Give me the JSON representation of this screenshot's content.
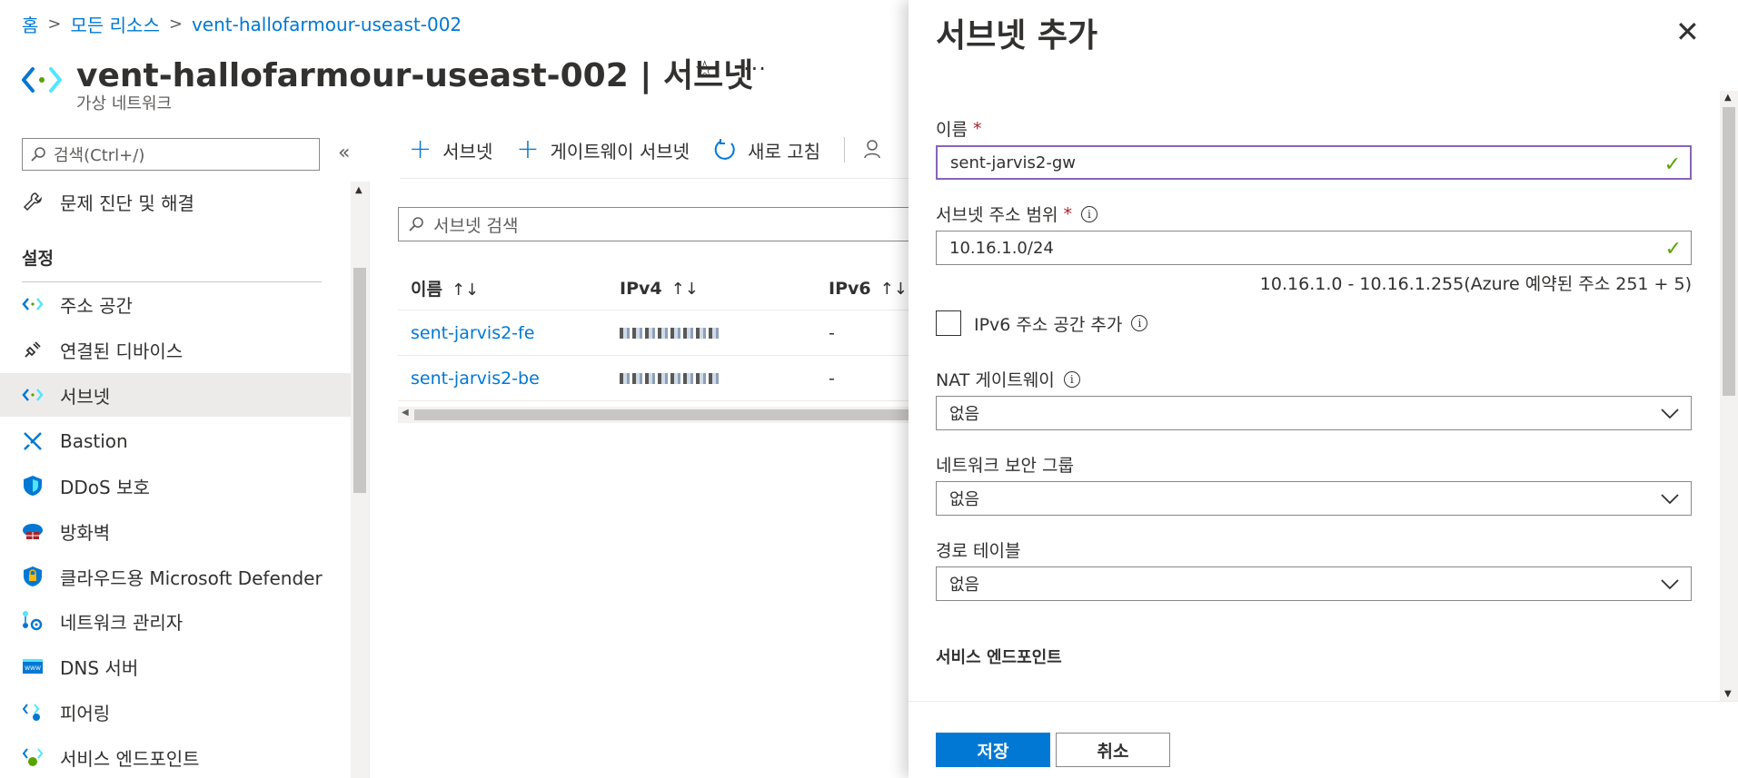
{
  "breadcrumb": {
    "items": [
      "홈",
      "모든 리소스",
      "vent-hallofarmour-useast-002"
    ]
  },
  "header": {
    "title": "vent-hallofarmour-useast-002 | 서브넷",
    "subtitle": "가상 네트워크",
    "star": "☆",
    "more": "···"
  },
  "sidebar": {
    "search_placeholder": "검색(Ctrl+/)",
    "collapse": "«",
    "section_settings": "설정",
    "items": [
      {
        "label": "문제 진단 및 해결",
        "icon": "wrench-icon"
      },
      {
        "label": "주소 공간",
        "icon": "address-space-icon"
      },
      {
        "label": "연결된 디바이스",
        "icon": "plug-icon"
      },
      {
        "label": "서브넷",
        "icon": "subnet-icon"
      },
      {
        "label": "Bastion",
        "icon": "bastion-icon"
      },
      {
        "label": "DDoS 보호",
        "icon": "shield-icon"
      },
      {
        "label": "방화벽",
        "icon": "firewall-icon"
      },
      {
        "label": "클라우드용 Microsoft Defender",
        "icon": "defender-icon"
      },
      {
        "label": "네트워크 관리자",
        "icon": "network-manager-icon"
      },
      {
        "label": "DNS 서버",
        "icon": "dns-icon"
      },
      {
        "label": "피어링",
        "icon": "peering-icon"
      },
      {
        "label": "서비스 엔드포인트",
        "icon": "service-endpoint-icon"
      }
    ]
  },
  "toolbar": {
    "add_subnet": "서브넷",
    "add_gateway_subnet": "게이트웨이 서브넷",
    "refresh": "새로 고침"
  },
  "grid": {
    "search_placeholder": "서브넷 검색",
    "headers": [
      "이름",
      "IPv4",
      "IPv6"
    ],
    "sort": "↑↓",
    "rows": [
      {
        "name": "sent-jarvis2-fe",
        "ipv6": "-"
      },
      {
        "name": "sent-jarvis2-be",
        "ipv6": "-"
      }
    ]
  },
  "panel": {
    "title": "서브넷 추가",
    "close": "✕",
    "name_label": "이름",
    "required": "*",
    "name_value": "sent-jarvis2-gw",
    "range_label": "서브넷 주소 범위",
    "range_value": "10.16.1.0/24",
    "range_hint": "10.16.1.0 - 10.16.1.255(Azure 예약된 주소 251 + 5)",
    "ipv6_checkbox": "IPv6 주소 공간 추가",
    "nat_label": "NAT 게이트웨이",
    "nat_value": "없음",
    "nsg_label": "네트워크 보안 그룹",
    "nsg_value": "없음",
    "route_label": "경로 테이블",
    "route_value": "없음",
    "service_endpoints": "서비스 엔드포인트",
    "info": "i",
    "check": "✓",
    "save": "저장",
    "cancel": "취소"
  },
  "colors": {
    "accent": "#0078d4",
    "valid": "#57a300",
    "active_border": "#8764b8"
  }
}
